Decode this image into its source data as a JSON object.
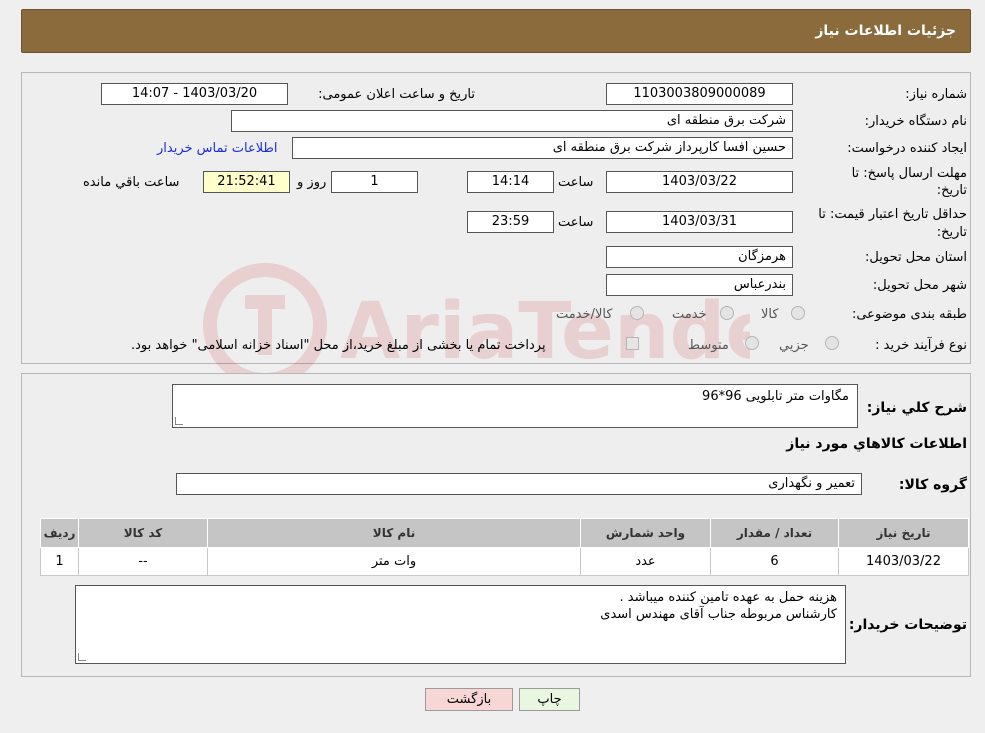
{
  "header": {
    "title": "جزئیات اطلاعات نیاز"
  },
  "details": {
    "need_number_label": "شماره نیاز:",
    "need_number": "1103003809000089",
    "announce_label": "تاریخ و ساعت اعلان عمومی:",
    "announce_value": "1403/03/20 - 14:07",
    "buyer_org_label": "نام دستگاه خریدار:",
    "buyer_org": "شرکت برق منطقه ای",
    "creator_label": "ایجاد کننده درخواست:",
    "creator": "حسین افسا کارپرداز شرکت برق منطقه ای",
    "contact_link": "اطلاعات تماس خریدار",
    "deadline_label_1": "مهلت ارسال پاسخ: تا",
    "deadline_label_2": "تاریخ:",
    "deadline_date": "1403/03/22",
    "time_label": "ساعت",
    "deadline_time": "14:14",
    "days": "1",
    "days_label": "روز و",
    "remaining": "21:52:41",
    "remaining_label": "ساعت باقي مانده",
    "validity_label_1": "حداقل تاریخ اعتبار قیمت: تا",
    "validity_label_2": "تاریخ:",
    "validity_date": "1403/03/31",
    "validity_time": "23:59",
    "province_label": "استان محل تحویل:",
    "province": "هرمزگان",
    "city_label": "شهر محل تحویل:",
    "city": "بندرعباس",
    "category_label": "طبقه بندی موضوعی:",
    "category_options": [
      "کالا",
      "خدمت",
      "کالا/خدمت"
    ],
    "process_label": "نوع فرآیند خرید :",
    "process_options": [
      "جزیي",
      "متوسط"
    ],
    "payment_note": "پرداخت تمام یا بخشی از مبلغ خرید،از محل \"اسناد خزانه اسلامی\" خواهد بود."
  },
  "summary": {
    "general_desc_label": "شرح كلي نياز:",
    "general_desc": "مگاوات متر تابلویی 96*96",
    "goods_info_title": "اطلاعات کالاهاي مورد نياز",
    "goods_group_label": "گروه کالا:",
    "goods_group": "تعمیر و نگهداری"
  },
  "table": {
    "headers": [
      "رديف",
      "کد کالا",
      "نام کالا",
      "واحد شمارش",
      "تعداد / مقدار",
      "تاریخ نیاز"
    ],
    "rows": [
      [
        "1",
        "--",
        "وات متر",
        "عدد",
        "6",
        "1403/03/22"
      ]
    ]
  },
  "buyer_notes": {
    "label": "توضیحات خریدار:",
    "line1": "هزینه حمل به عهده تامین کننده میباشد .",
    "line2": "کارشناس مربوطه جناب آقای مهندس اسدی"
  },
  "buttons": {
    "print": "چاپ",
    "back": "بازگشت"
  },
  "watermark": {
    "text": "AriaTender.neT"
  },
  "colors": {
    "header_bg": "#8b6a3c",
    "link": "#1a2fd8",
    "back_btn": "#f7d6d6",
    "print_btn": "#e9f7e0"
  }
}
